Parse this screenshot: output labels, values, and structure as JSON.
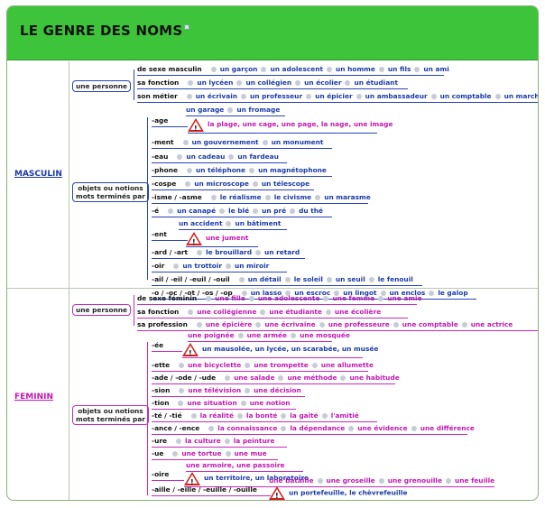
{
  "title": "LE GENRE DES NOMS",
  "masculin": {
    "label": "MASCULIN",
    "personne_label": "une personne",
    "objets_label_1": "objets ou notions",
    "objets_label_2": "mots terminés par",
    "personne_rows": [
      {
        "label": "de sexe masculin",
        "words": [
          "un garçon",
          "un adolescent",
          "un homme",
          "un fils",
          "un ami"
        ]
      },
      {
        "label": "sa fonction",
        "words": [
          "un lycéen",
          "un collégien",
          "un écolier",
          "un étudiant"
        ]
      },
      {
        "label": "son métier",
        "words": [
          "un écrivain",
          "un professeur",
          "un épicier",
          "un ambassadeur",
          "un comptable",
          "un marchand"
        ]
      }
    ],
    "age_words": [
      "un garage",
      "un fromage"
    ],
    "age_label": "-age",
    "age_exception": "la plage, une cage, une page, la nage, une image",
    "suffix_rows": [
      {
        "label": "-ment",
        "words": [
          "un gouvernement",
          "un monument"
        ]
      },
      {
        "label": "-eau",
        "words": [
          "un cadeau",
          "un fardeau"
        ]
      },
      {
        "label": "-phone",
        "words": [
          "un téléphone",
          "un magnétophone"
        ]
      },
      {
        "label": "-cospe",
        "words": [
          "un microscope",
          "un télescope"
        ]
      },
      {
        "label": "-isme / -asme",
        "words": [
          "le réalisme",
          "le civisme",
          "un marasme"
        ]
      },
      {
        "label": "-é",
        "words": [
          "un canapé",
          "le blé",
          "un pré",
          "du thé"
        ]
      }
    ],
    "ent_words": [
      "un accident",
      "un bâtiment"
    ],
    "ent_label": "-ent",
    "ent_exception": "une jument",
    "suffix_rows_2": [
      {
        "label": "-ard / -art",
        "words": [
          "le brouillard",
          "un retard"
        ]
      },
      {
        "label": "-oir",
        "words": [
          "un trottoir",
          "un miroir"
        ]
      },
      {
        "label": "-ail / -eil / -euil / -ouil",
        "words": [
          "un détail",
          "le soleil",
          "un seuil",
          "le fenouil"
        ]
      },
      {
        "label": "-o / -oc / -ot / -os / -op",
        "words": [
          "un lasso",
          "un escroc",
          "un lingot",
          "un enclos",
          "le galop"
        ]
      }
    ]
  },
  "feminin": {
    "label": "FEMININ",
    "personne_label": "une personne",
    "objets_label_1": "objets ou notions",
    "objets_label_2": "mots terminés par",
    "personne_rows": [
      {
        "label": "de sexe féminin",
        "words": [
          "une fille",
          "une adolescente",
          "une femme",
          "une amie"
        ]
      },
      {
        "label": "sa fonction",
        "words": [
          "une collégienne",
          "une étudiante",
          "une écolière"
        ]
      },
      {
        "label": "sa profession",
        "words": [
          "une épicière",
          "une écrivaine",
          "une professeure",
          "une comptable",
          "une actrice"
        ]
      }
    ],
    "ee_words": [
      "une poignée",
      "une armée",
      "une mosquée"
    ],
    "ee_label": "-ée",
    "ee_exception": "un mausolée, un lycée, un scarabée, un musée",
    "suffix_rows": [
      {
        "label": "-ette",
        "words": [
          "une bicyclette",
          "une trompette",
          "une allumette"
        ]
      },
      {
        "label": "-ade / -ode / -ude",
        "words": [
          "une salade",
          "une méthode",
          "une habitude"
        ]
      },
      {
        "label": "-sion",
        "words": [
          "une télévision",
          "une décision"
        ]
      },
      {
        "label": "-tion",
        "words": [
          "une situation",
          "une notion"
        ]
      },
      {
        "label": "-té / -tié",
        "words": [
          "la réalité",
          "la bonté",
          "la gaîté",
          "l'amitié"
        ]
      },
      {
        "label": "-ance / -ence",
        "words": [
          "la connaissance",
          "la dépendance",
          "une évidence",
          "une différence"
        ]
      },
      {
        "label": "-ure",
        "words": [
          "la culture",
          "la peinture"
        ]
      },
      {
        "label": "-ue",
        "words": [
          "une tortue",
          "une mue"
        ]
      }
    ],
    "oire_words": "une armoire, une passoire",
    "oire_label": "-oire",
    "oire_exception": "un territoire, un laboratoire",
    "aille_words": [
      "une bataille",
      "une groseille",
      "une grenouille",
      "une feuille"
    ],
    "aille_label": "-aille / -eille / -euille / -ouille",
    "aille_exception": "un portefeuille, le chèvrefeuille"
  }
}
